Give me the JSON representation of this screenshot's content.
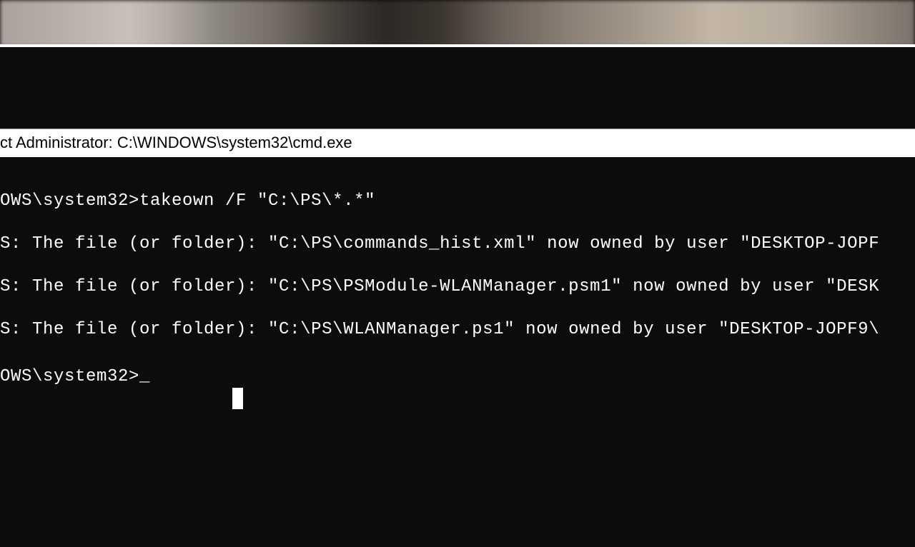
{
  "titlebar": {
    "title": "ct Administrator: C:\\WINDOWS\\system32\\cmd.exe"
  },
  "terminal": {
    "lines": [
      "OWS\\system32>takeown /F \"C:\\PS\\*.*\"",
      "S: The file (or folder): \"C:\\PS\\commands_hist.xml\" now owned by user \"DESKTOP-JOPF",
      "S: The file (or folder): \"C:\\PS\\PSModule-WLANManager.psm1\" now owned by user \"DESK",
      "S: The file (or folder): \"C:\\PS\\WLANManager.ps1\" now owned by user \"DESKTOP-JOPF9\\",
      "OWS\\system32>"
    ],
    "cursor": "_"
  }
}
